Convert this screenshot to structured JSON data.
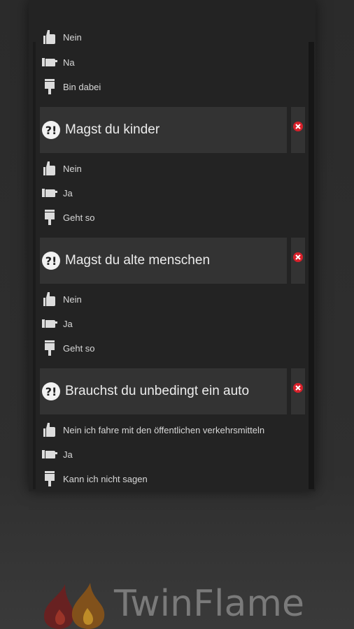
{
  "questions": [
    {
      "title": "",
      "answers": [
        {
          "icon": "thumb-up-icon",
          "label": "Nein"
        },
        {
          "icon": "thumb-side-icon",
          "label": "Na"
        },
        {
          "icon": "thumb-down-icon",
          "label": "Bin dabei"
        }
      ]
    },
    {
      "title": "Magst du kinder",
      "answers": [
        {
          "icon": "thumb-up-icon",
          "label": "Nein"
        },
        {
          "icon": "thumb-side-icon",
          "label": "Ja"
        },
        {
          "icon": "thumb-down-icon",
          "label": "Geht so"
        }
      ]
    },
    {
      "title": "Magst du alte menschen",
      "answers": [
        {
          "icon": "thumb-up-icon",
          "label": "Nein"
        },
        {
          "icon": "thumb-side-icon",
          "label": "Ja"
        },
        {
          "icon": "thumb-down-icon",
          "label": "Geht so"
        }
      ]
    },
    {
      "title": "Brauchst du unbedingt ein auto",
      "answers": [
        {
          "icon": "thumb-up-icon",
          "label": "Nein ich fahre mit den öffentlichen verkehrsmitteln"
        },
        {
          "icon": "thumb-side-icon",
          "label": "Ja"
        },
        {
          "icon": "thumb-down-icon",
          "label": "Kann ich nicht sagen"
        }
      ]
    }
  ],
  "question_icon": "question-exclamation-icon",
  "delete_icon": "delete-x-icon",
  "brand": {
    "name": "TwinFlame"
  },
  "colors": {
    "delete_red": "#d8202a",
    "panel_bg": "#232323",
    "question_bg": "#333333"
  }
}
